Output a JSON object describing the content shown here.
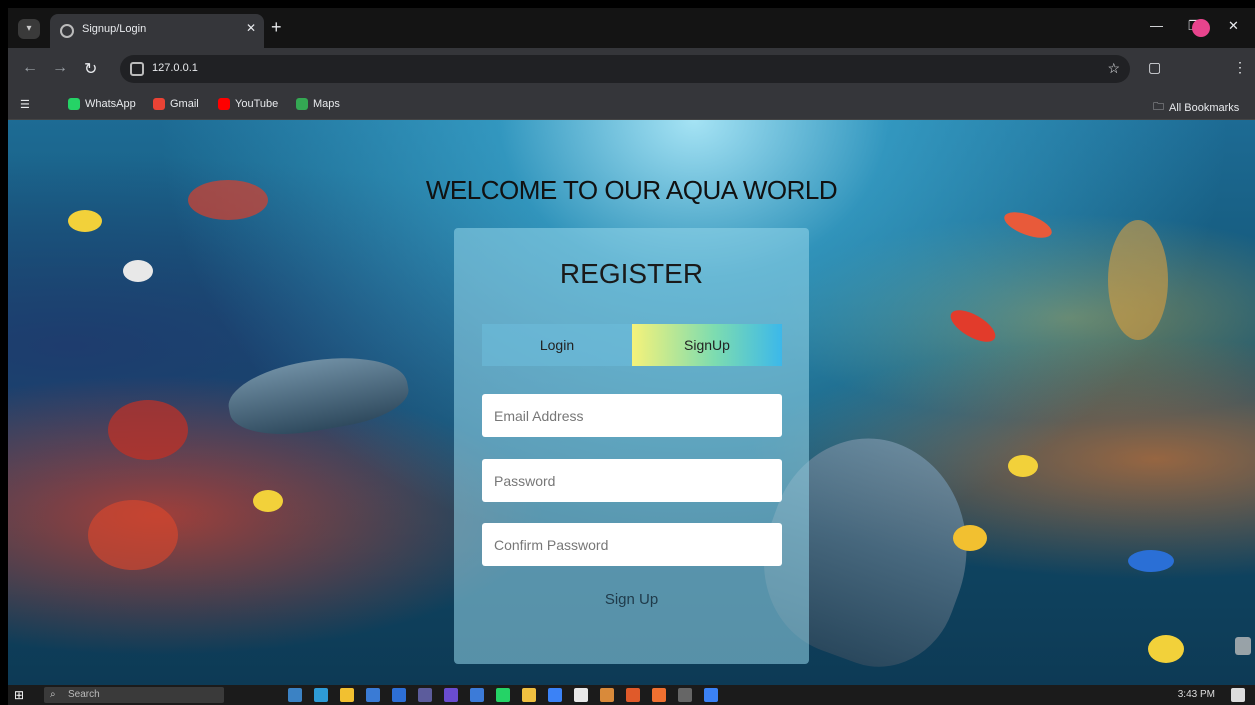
{
  "browser": {
    "tab_title": "Signup/Login",
    "url": "127.0.0.1",
    "bookmarks": [
      {
        "label": "WhatsApp",
        "color": "#25d366"
      },
      {
        "label": "Gmail",
        "color": "#ea4335"
      },
      {
        "label": "YouTube",
        "color": "#ff0000"
      },
      {
        "label": "Maps",
        "color": "#34a853"
      }
    ],
    "all_bookmarks": "All Bookmarks"
  },
  "page": {
    "welcome": "WELCOME TO OUR AQUA WORLD",
    "card_title": "REGISTER",
    "tabs": [
      {
        "label": "Login"
      },
      {
        "label": "SignUp"
      }
    ],
    "active_tab": "SignUp",
    "fields": {
      "email_placeholder": "Email Address",
      "password_placeholder": "Password",
      "confirm_placeholder": "Confirm Password"
    },
    "submit_label": "Sign Up"
  },
  "taskbar": {
    "search_placeholder": "Search",
    "clock": "3:43 PM"
  }
}
